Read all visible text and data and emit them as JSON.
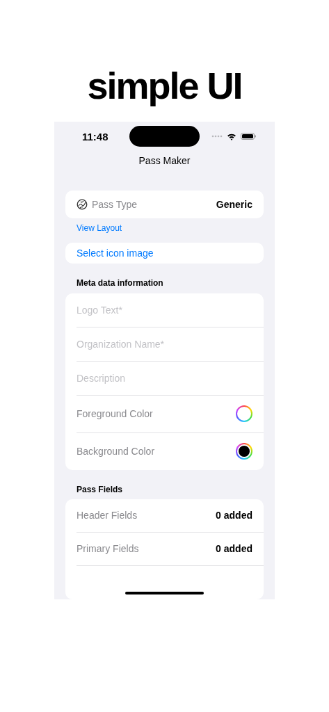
{
  "headline": "simple UI",
  "status_bar": {
    "time": "11:48"
  },
  "nav": {
    "title": "Pass Maker"
  },
  "pass_type": {
    "label": "Pass Type",
    "value": "Generic",
    "link": "View Layout"
  },
  "icon_button": {
    "label": "Select icon image"
  },
  "meta": {
    "header": "Meta data information",
    "rows": [
      {
        "kind": "field",
        "placeholder": "Logo Text*"
      },
      {
        "kind": "field",
        "placeholder": "Organization Name*"
      },
      {
        "kind": "field",
        "placeholder": "Description"
      },
      {
        "kind": "color",
        "label": "Foreground Color",
        "color": "#ffffff"
      },
      {
        "kind": "color",
        "label": "Background Color",
        "color": "#000000"
      }
    ]
  },
  "fields": {
    "header": "Pass Fields",
    "rows": [
      {
        "label": "Header Fields",
        "value": "0 added"
      },
      {
        "label": "Primary Fields",
        "value": "0 added"
      }
    ]
  }
}
